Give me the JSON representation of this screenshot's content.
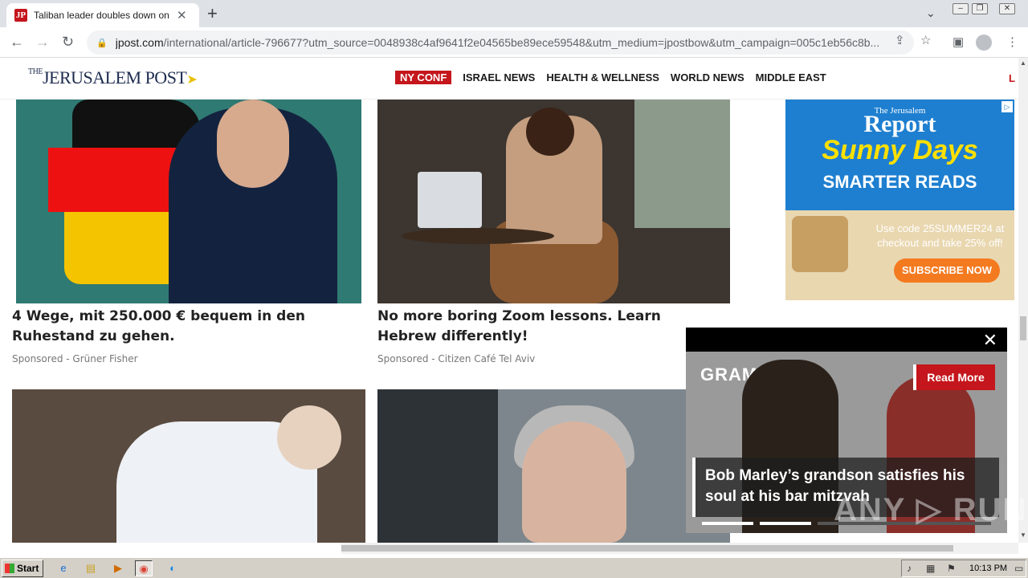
{
  "browser": {
    "tab_title": "Taliban leader doubles down on treat",
    "tab_favicon": "JP",
    "url_host": "jpost.com",
    "url_path": "/international/article-796677?utm_source=0048938c4af9641f2e04565be89ece59548&utm_medium=jpostbow&utm_campaign=005c1eb56c8b..."
  },
  "site": {
    "logo_the": "THE",
    "logo_name": "JERUSALEM POST",
    "nav": [
      "NY CONF",
      "ISRAEL NEWS",
      "HEALTH & WELLNESS",
      "WORLD NEWS",
      "MIDDLE EAST"
    ],
    "nav_edge": "L",
    "accent": "#c4161c"
  },
  "cards": [
    {
      "headline": "4 Wege, mit 250.000 € bequem in den Ruhestand zu gehen.",
      "sponsor": "Sponsored - Grüner Fisher"
    },
    {
      "headline": "No more boring Zoom lessons. Learn Hebrew differently!",
      "sponsor": "Sponsored - Citizen Café Tel Aviv"
    }
  ],
  "ad": {
    "brand_top": "The Jerusalem",
    "brand_main": "Report",
    "headline": "Sunny Days",
    "subhead": "SMARTER READS",
    "promo": "Use code 25SUMMER24 at checkout and take 25% off!",
    "cta": "SUBSCRIBE NOW",
    "adchoice": "▷"
  },
  "popup": {
    "read_more": "Read More",
    "caption": "Bob Marley’s grandson satisfies his soul at his bar mitzvah",
    "bg_sign": "GRAM        DS",
    "close_icon": "✕",
    "progress": [
      1,
      1,
      0
    ]
  },
  "watermark": "ANY ▷ RUN",
  "taskbar": {
    "start": "Start",
    "clock": "10:13 PM"
  }
}
